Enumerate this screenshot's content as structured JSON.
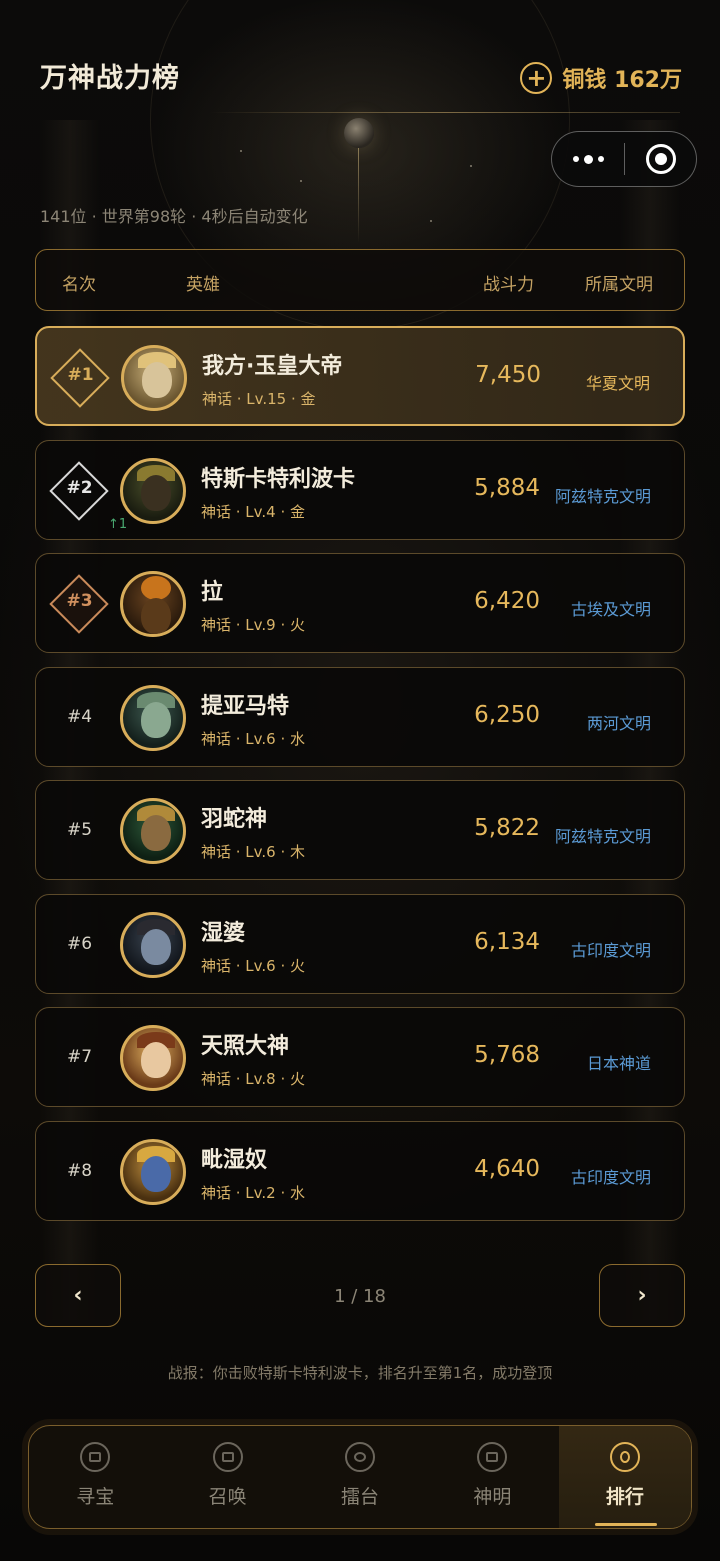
{
  "header": {
    "title": "万神战力榜",
    "coins_label": "铜钱 162万"
  },
  "subtitle": "141位 · 世界第98轮 · 4秒后自动变化",
  "table_head": {
    "rank": "名次",
    "hero": "英雄",
    "power": "战斗力",
    "civ": "所属文明"
  },
  "rows": [
    {
      "rank": "#1",
      "name": "我方·玉皇大帝",
      "meta": "神话 · Lv.15 · 金",
      "power": "7,450",
      "civ": "华夏文明",
      "change": ""
    },
    {
      "rank": "#2",
      "name": "特斯卡特利波卡",
      "meta": "神话 · Lv.4 · 金",
      "power": "5,884",
      "civ": "阿兹特克文明",
      "change": "↑1"
    },
    {
      "rank": "#3",
      "name": "拉",
      "meta": "神话 · Lv.9 · 火",
      "power": "6,420",
      "civ": "古埃及文明",
      "change": ""
    },
    {
      "rank": "#4",
      "name": "提亚马特",
      "meta": "神话 · Lv.6 · 水",
      "power": "6,250",
      "civ": "两河文明",
      "change": ""
    },
    {
      "rank": "#5",
      "name": "羽蛇神",
      "meta": "神话 · Lv.6 · 木",
      "power": "5,822",
      "civ": "阿兹特克文明",
      "change": ""
    },
    {
      "rank": "#6",
      "name": "湿婆",
      "meta": "神话 · Lv.6 · 火",
      "power": "6,134",
      "civ": "古印度文明",
      "change": ""
    },
    {
      "rank": "#7",
      "name": "天照大神",
      "meta": "神话 · Lv.8 · 火",
      "power": "5,768",
      "civ": "日本神道",
      "change": ""
    },
    {
      "rank": "#8",
      "name": "毗湿奴",
      "meta": "神话 · Lv.2 · 水",
      "power": "4,640",
      "civ": "古印度文明",
      "change": ""
    }
  ],
  "pager": {
    "prev": "‹",
    "next": "›",
    "info": "1 / 18"
  },
  "report": "战报：你击败特斯卡特利波卡，排名升至第1名，成功登顶",
  "tabs": [
    {
      "label": "寻宝",
      "icon": "treasure-icon"
    },
    {
      "label": "召唤",
      "icon": "summon-icon"
    },
    {
      "label": "擂台",
      "icon": "arena-icon"
    },
    {
      "label": "神明",
      "icon": "deity-icon"
    },
    {
      "label": "排行",
      "icon": "ranking-icon",
      "active": true
    }
  ],
  "colors": {
    "gold": "#e2b458",
    "civ_blue": "#5b9ad4",
    "rise_green": "#4aa870"
  }
}
